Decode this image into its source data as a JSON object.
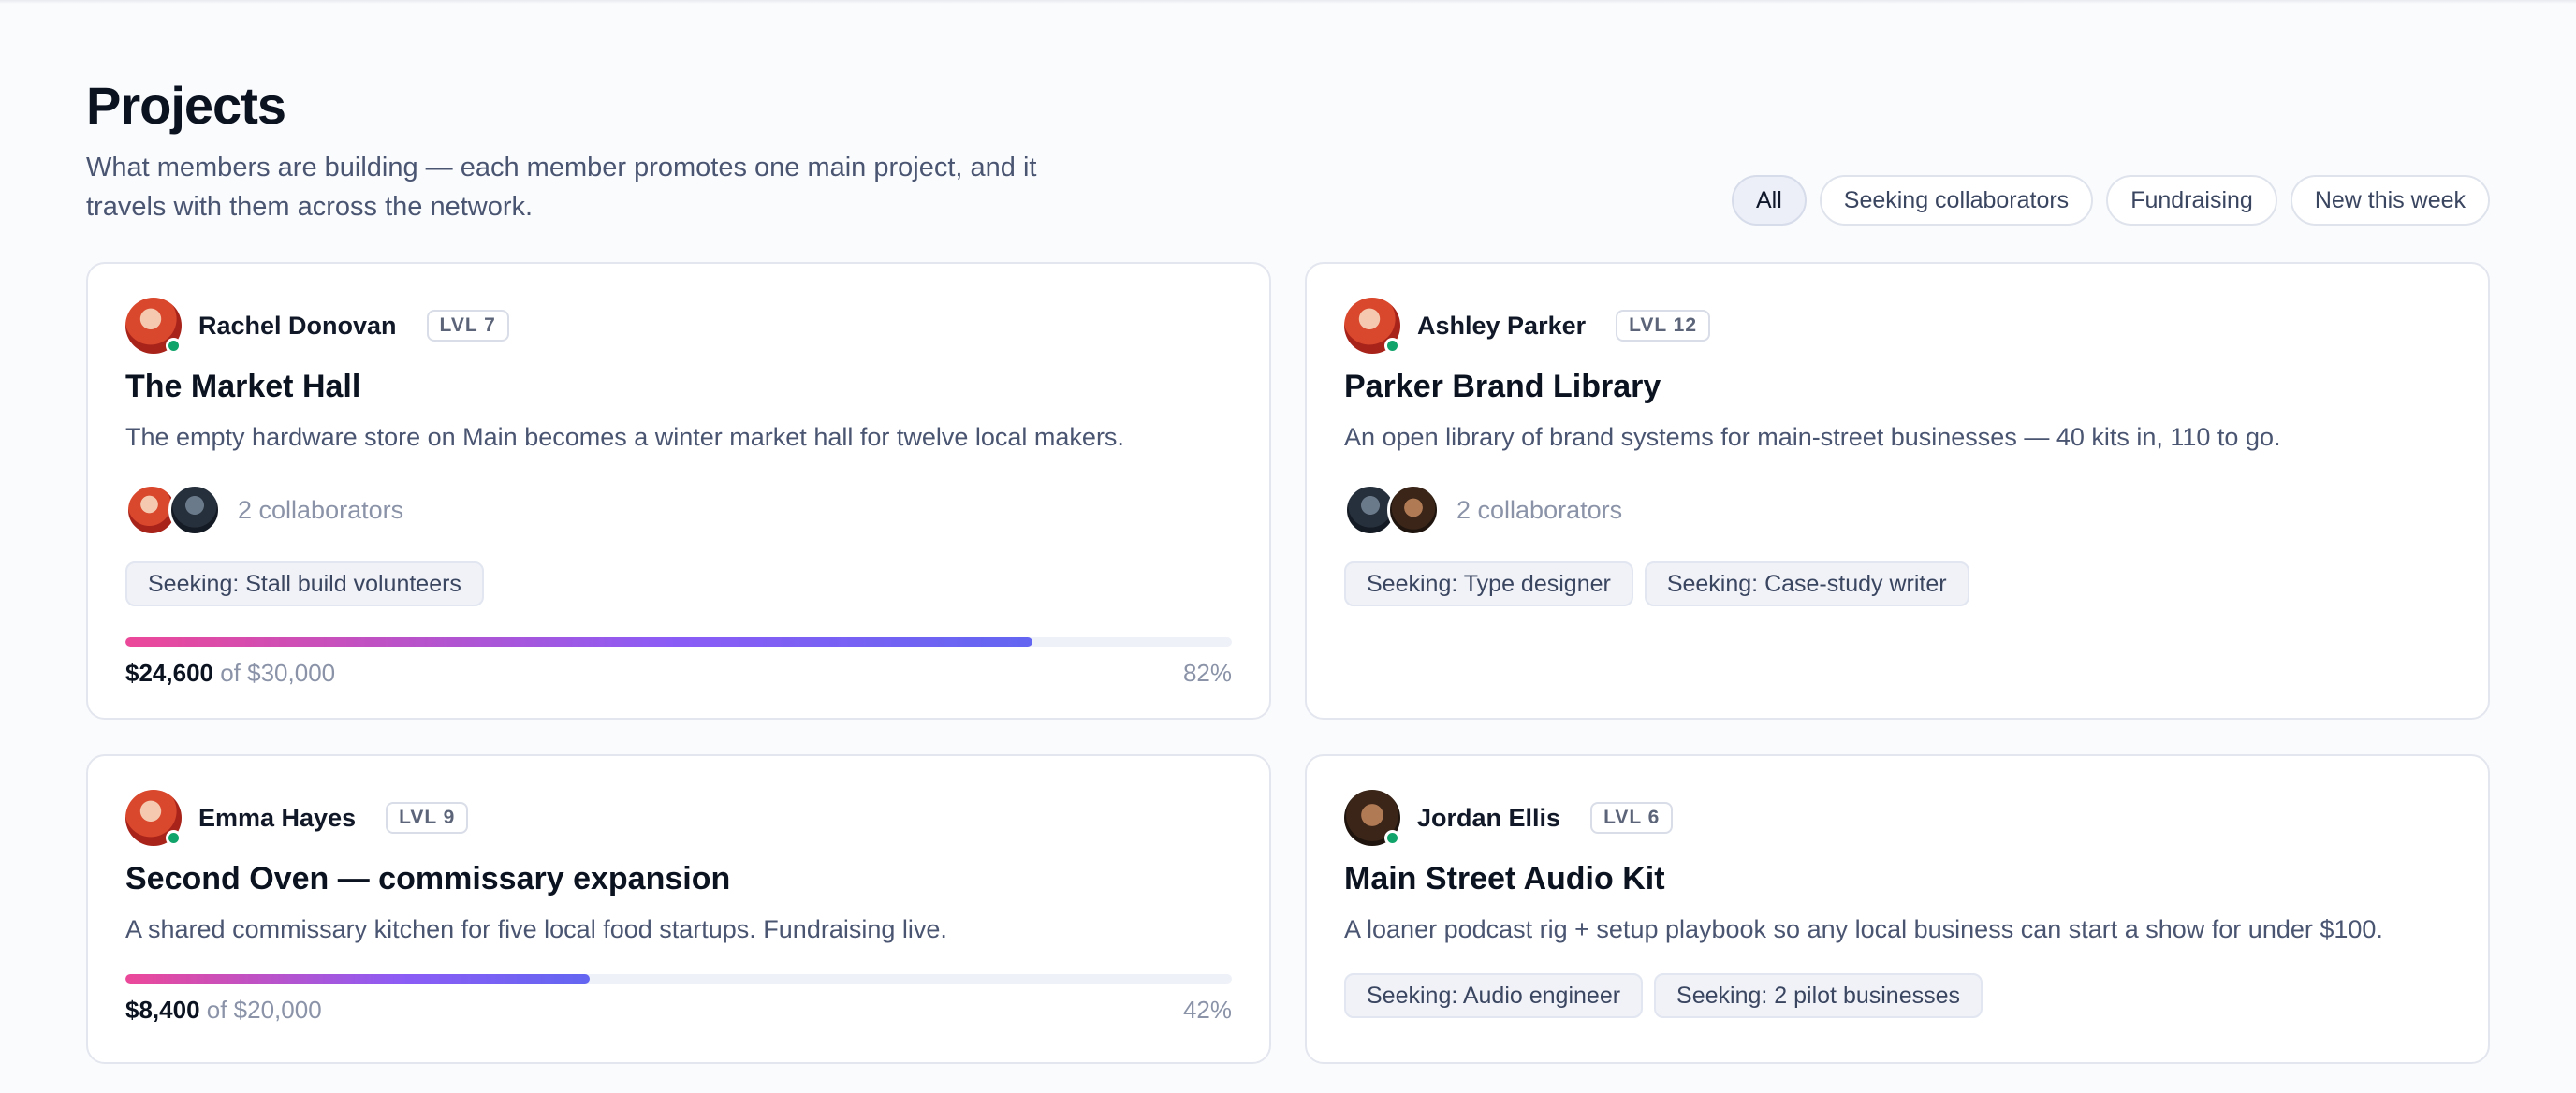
{
  "header": {
    "title": "Projects",
    "subtitle_line1": "What members are building — each member promotes one main project, and it",
    "subtitle_line2": "travels with them across the network."
  },
  "filters": [
    {
      "label": "All",
      "active": true
    },
    {
      "label": "Seeking collaborators",
      "active": false
    },
    {
      "label": "Fundraising",
      "active": false
    },
    {
      "label": "New this week",
      "active": false
    }
  ],
  "projects": [
    {
      "owner": "Rachel Donovan",
      "level": "LVL 7",
      "title": "The Market Hall",
      "description": "The empty hardware store on Main becomes a winter market hall for twelve local makers.",
      "collaborators_text": "2 collaborators",
      "tags": [
        "Seeking: Stall build volunteers"
      ],
      "raised": "$24,600",
      "goal_text": "of $30,000",
      "percent": "82%",
      "progress": 0.82
    },
    {
      "owner": "Ashley Parker",
      "level": "LVL 12",
      "title": "Parker Brand Library",
      "description": "An open library of brand systems for main-street businesses — 40 kits in, 110 to go.",
      "collaborators_text": "2 collaborators",
      "tags": [
        "Seeking: Type designer",
        "Seeking: Case-study writer"
      ]
    },
    {
      "owner": "Emma Hayes",
      "level": "LVL 9",
      "title": "Second Oven — commissary expansion",
      "description": "A shared commissary kitchen for five local food startups. Fundraising live.",
      "raised": "$8,400",
      "goal_text": "of $20,000",
      "percent": "42%",
      "progress": 0.42
    },
    {
      "owner": "Jordan Ellis",
      "level": "LVL 6",
      "title": "Main Street Audio Kit",
      "description": "A loaner podcast rig + setup playbook so any local business can start a show for under $100.",
      "tags": [
        "Seeking: Audio engineer",
        "Seeking: 2 pilot businesses"
      ]
    }
  ],
  "colors": {
    "progress_start": "#ec4899",
    "progress_end": "#6366f1",
    "online": "#10a36a"
  }
}
